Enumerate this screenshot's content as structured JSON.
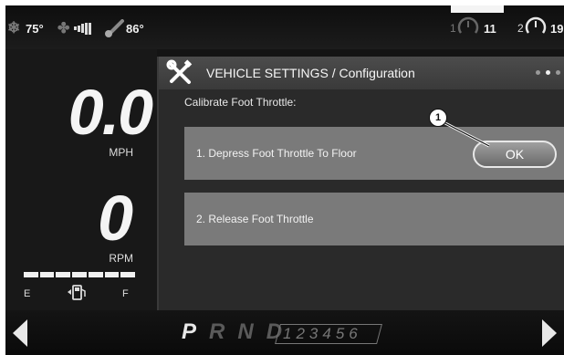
{
  "status_bar": {
    "cabin_temp": "75°",
    "outside_temp": "86°",
    "trip_1_index": "1",
    "trip_1_value": "11",
    "trip_2_index": "2",
    "trip_2_value": "19"
  },
  "gauges": {
    "speed_value": "0.0",
    "speed_unit": "MPH",
    "rpm_value": "0",
    "rpm_unit": "RPM",
    "fuel_empty_label": "E",
    "fuel_full_label": "F",
    "fuel_level": 1.0
  },
  "settings_panel": {
    "title": "VEHICLE SETTINGS / Configuration",
    "subtitle": "Calibrate Foot Throttle:",
    "steps": [
      {
        "label": "1. Depress Foot Throttle To Floor"
      },
      {
        "label": "2. Release Foot Throttle"
      }
    ],
    "ok_label": "OK",
    "callout_number": "1"
  },
  "gear_selector": {
    "gears": [
      "P",
      "R",
      "N",
      "D"
    ],
    "active_gear": "P",
    "manual_gears": "123456"
  },
  "icons": {
    "snow": "snowflake-icon",
    "fan": "fan-icon",
    "signal": "signal-strength-icon",
    "thermometer": "thermometer-icon",
    "wrench": "wrench-screwdriver-icon",
    "fuel": "fuel-pump-icon",
    "prev": "arrow-left-icon",
    "next": "arrow-right-icon"
  },
  "colors": {
    "background": "#141414",
    "step_row": "#7a7a7a",
    "header": "#4c4c4c"
  }
}
